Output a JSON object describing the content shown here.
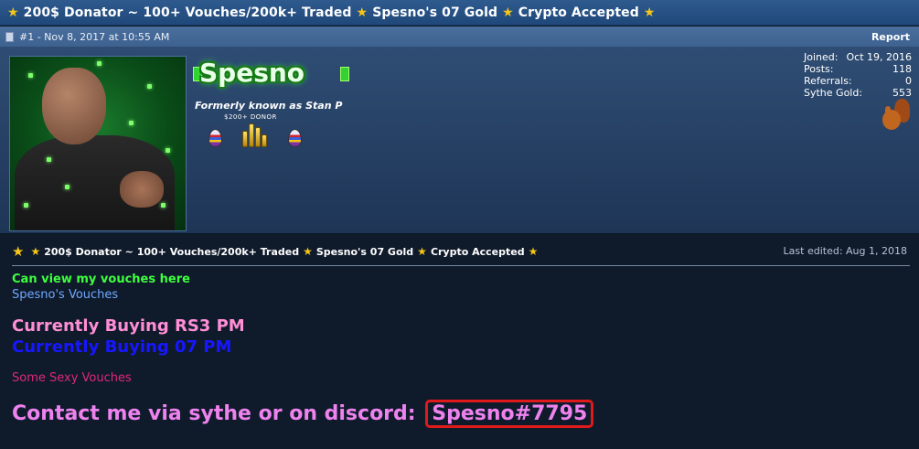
{
  "thread": {
    "title": "200$ Donator ~ 100+ Vouches/200k+ Traded",
    "title_part2": "Spesno's 07 Gold",
    "title_part3": "Crypto Accepted"
  },
  "post": {
    "number_date": "#1 - Nov 8, 2017 at 10:55 AM",
    "report_label": "Report"
  },
  "user": {
    "name": "Spesno",
    "title": "Formerly known as Stan P",
    "rank": "$200+ DONOR",
    "stats": [
      {
        "label": "Joined:",
        "value": "Oct 19, 2016"
      },
      {
        "label": "Posts:",
        "value": "118"
      },
      {
        "label": "Referrals:",
        "value": "0"
      },
      {
        "label": "Sythe Gold:",
        "value": "553"
      }
    ]
  },
  "signature": {
    "headline": "200$ Donator ~ 100+ Vouches/200k+ Traded",
    "headline_part2": "Spesno's 07 Gold",
    "headline_part3": "Crypto Accepted",
    "last_edited": "Last edited: Aug 1, 2018"
  },
  "body": {
    "line1": "Can view my vouches here",
    "line2": "Spesno's Vouches",
    "line3": "Currently Buying RS3 PM",
    "line4": "Currently Buying 07 PM",
    "line5": "Some Sexy Vouches",
    "line6_prefix": "Contact me via sythe or on discord:",
    "discord": "Spesno#7795"
  },
  "colors": {
    "accent_green": "#3dff3d",
    "link_blue": "#6fa8ff",
    "pink": "#ff8ed6",
    "highlight_red": "#e01a1a"
  }
}
